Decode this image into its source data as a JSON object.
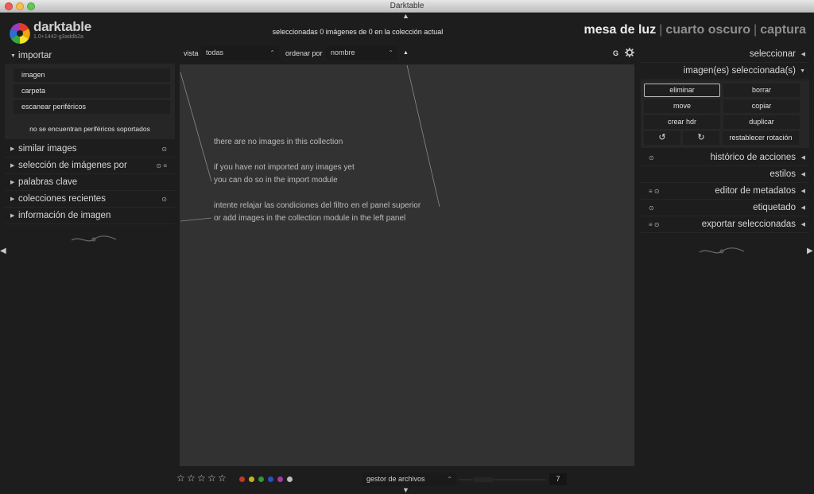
{
  "window": {
    "title": "Darktable"
  },
  "app": {
    "name": "darktable",
    "version": "1.0+1442-g3addb2a"
  },
  "header": {
    "status": "seleccionadas 0 imágenes de 0 en la colección actual",
    "views": [
      "mesa de luz",
      "cuarto oscuro",
      "captura"
    ],
    "active_view": "mesa de luz",
    "separator": "|"
  },
  "left_panel": {
    "import": {
      "title": "importar",
      "buttons": [
        "imagen",
        "carpeta",
        "escanear periféricos"
      ],
      "note": "no se encuentran periféricos soportados"
    },
    "modules": [
      {
        "label": "similar images",
        "icons": "⊙"
      },
      {
        "label": "selección de imágenes por",
        "icons": "⊙  ≡"
      },
      {
        "label": "palabras clave",
        "icons": ""
      },
      {
        "label": "colecciones recientes",
        "icons": "⊙"
      },
      {
        "label": "información de imagen",
        "icons": ""
      }
    ]
  },
  "filterbar": {
    "vista_label": "vista",
    "vista_value": "todas",
    "sort_label": "ordenar por",
    "sort_value": "nombre",
    "sort_dir": "▲",
    "grouping": "G",
    "settings_icon": "gear-icon"
  },
  "center": {
    "line1": "there are no images in this collection",
    "line2": "if you have not imported any images yet",
    "line3": "you can do so in the import module",
    "line4": "intente relajar las condiciones del filtro en el panel superior",
    "line5": "or add images in the collection module in the left panel"
  },
  "bottombar": {
    "stars": [
      "☆",
      "☆",
      "☆",
      "☆",
      "☆"
    ],
    "color_labels": [
      "#c0392b",
      "#c9b21a",
      "#2e9b2e",
      "#2a4fc4",
      "#a43aa4",
      "#bdbdbd"
    ],
    "layout": "gestor de archivos",
    "zoom": "7"
  },
  "right_panel": {
    "select": {
      "label": "seleccionar"
    },
    "selected_images": {
      "title": "imagen(es) seleccionada(s)",
      "buttons": [
        "eliminar",
        "borrar",
        "move",
        "copiar",
        "crear hdr",
        "duplicar"
      ],
      "reset_rotation": "restablecer rotación",
      "rotate_left": "↺",
      "rotate_right": "↻"
    },
    "modules": [
      {
        "label": "histórico de acciones",
        "icons": "⊙"
      },
      {
        "label": "estilos",
        "icons": ""
      },
      {
        "label": "editor de metadatos",
        "icons": "≡  ⊙"
      },
      {
        "label": "etiquetado",
        "icons": "⊙"
      },
      {
        "label": "exportar seleccionadas",
        "icons": "≡  ⊙"
      }
    ]
  }
}
